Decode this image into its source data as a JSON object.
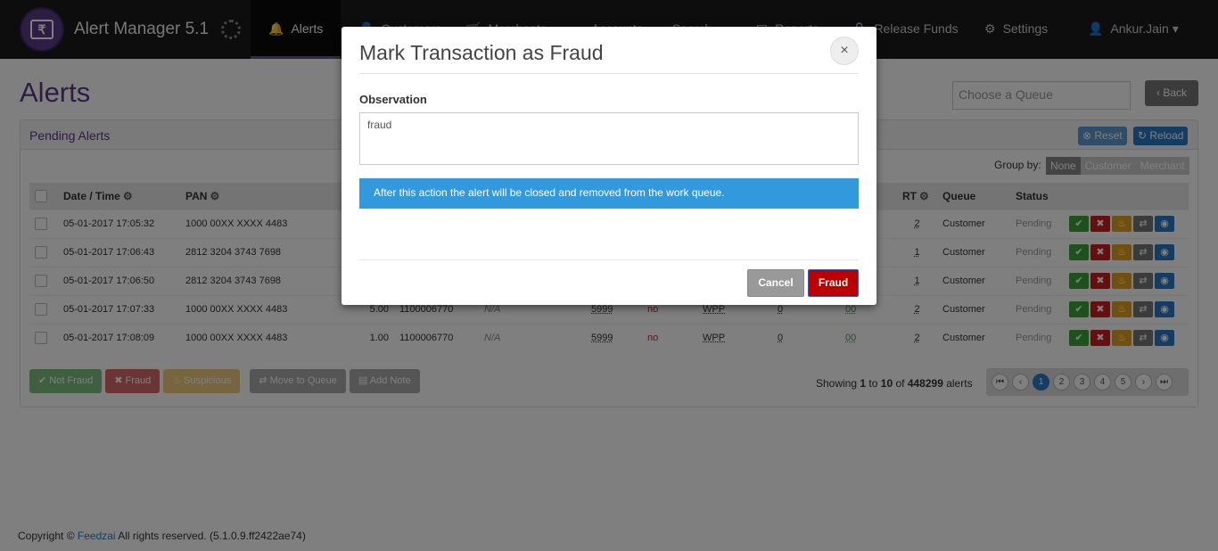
{
  "app": {
    "title": "Alert Manager 5.1",
    "logo_symbol": "₹"
  },
  "nav": {
    "items": [
      {
        "label": "Alerts",
        "icon": "bell-icon",
        "active": true
      },
      {
        "label": "Customers",
        "icon": "user-icon"
      },
      {
        "label": "Merchants",
        "icon": "cart-icon"
      },
      {
        "label": "Accounts",
        "icon": "card-icon"
      },
      {
        "label": "Search",
        "icon": "search-icon"
      },
      {
        "label": "Reports",
        "icon": "doc-icon"
      },
      {
        "label": "Release Funds",
        "icon": "lock-icon"
      },
      {
        "label": "Settings",
        "icon": "gear-icon"
      },
      {
        "label": "Ankur.Jain",
        "icon": "user-icon"
      }
    ]
  },
  "page": {
    "title": "Alerts",
    "queue_placeholder": "Choose a Queue",
    "back_label": "Back"
  },
  "panel": {
    "title": "Pending Alerts",
    "reset_label": "Reset",
    "reload_label": "Reload",
    "group_by_label": "Group by:",
    "group_by_options": [
      "None",
      "Customer",
      "Merchant"
    ],
    "group_by_selected": "None"
  },
  "table": {
    "columns": [
      "Date / Time",
      "PAN",
      "RT",
      "Queue",
      "Status"
    ],
    "rows": [
      {
        "datetime": "05-01-2017 17:05:32",
        "pan": "1000 00XX XXXX 4483",
        "amount": "",
        "account": "",
        "na": "",
        "mcc": "",
        "flag": "",
        "channel": "",
        "z": "",
        "oo": "",
        "rt": "2",
        "queue": "Customer",
        "status": "Pending"
      },
      {
        "datetime": "05-01-2017 17:06:43",
        "pan": "2812 3204 3743 7698",
        "amount": "",
        "account": "",
        "na": "",
        "mcc": "",
        "flag": "",
        "channel": "",
        "z": "",
        "oo": "",
        "rt": "1",
        "queue": "Customer",
        "status": "Pending"
      },
      {
        "datetime": "05-01-2017 17:06:50",
        "pan": "2812 3204 3743 7698",
        "amount": "",
        "account": "",
        "na": "",
        "mcc": "",
        "flag": "",
        "channel": "",
        "z": "",
        "oo": "",
        "rt": "1",
        "queue": "Customer",
        "status": "Pending"
      },
      {
        "datetime": "05-01-2017 17:07:33",
        "pan": "1000 00XX XXXX 4483",
        "amount": "5.00",
        "account": "1100006770",
        "na": "N/A",
        "mcc": "5999",
        "flag": "no",
        "channel": "WPP",
        "z": "0",
        "oo": "00",
        "rt": "2",
        "queue": "Customer",
        "status": "Pending"
      },
      {
        "datetime": "05-01-2017 17:08:09",
        "pan": "1000 00XX XXXX 4483",
        "amount": "1.00",
        "account": "1100006770",
        "na": "N/A",
        "mcc": "5999",
        "flag": "no",
        "channel": "WPP",
        "z": "0",
        "oo": "00",
        "rt": "2",
        "queue": "Customer",
        "status": "Pending"
      }
    ]
  },
  "bulk": {
    "not_fraud": "Not Fraud",
    "fraud": "Fraud",
    "suspicious": "Suspicious",
    "move": "Move to Queue",
    "note": "Add Note"
  },
  "pagination": {
    "showing_prefix": "Showing",
    "from": "1",
    "to_word": "to",
    "to": "10",
    "of_word": "of",
    "total": "448299",
    "suffix": "alerts",
    "pages": [
      "1",
      "2",
      "3",
      "4",
      "5"
    ],
    "current": "1"
  },
  "footer": {
    "prefix": "Copyright ©",
    "company": "Feedzai",
    "suffix": "All rights reserved. (5.1.0.9.ff2422ae74)"
  },
  "modal": {
    "title": "Mark Transaction as Fraud",
    "close": "×",
    "observation_label": "Observation",
    "observation_value": "fraud",
    "info": "After this action the alert will be closed and removed from the work queue.",
    "cancel": "Cancel",
    "confirm": "Fraud"
  },
  "colors": {
    "brand": "#5b3a87",
    "info": "#3399dd",
    "danger": "#bb0000",
    "primary": "#2a7ac8"
  }
}
